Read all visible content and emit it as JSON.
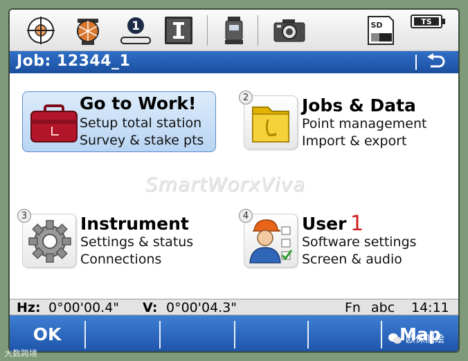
{
  "header": {
    "title": "Job: 12344_1"
  },
  "toolbar": {
    "icons": [
      "crosshair-target-icon",
      "prism-icon",
      "one-face-icon",
      "text-cursor-icon",
      "instrument-icon",
      "camera-icon",
      "sd-card-icon",
      "ts-battery-icon"
    ],
    "one_face_label": "1",
    "sd_label": "SD",
    "ts_label": "TS"
  },
  "tiles": [
    {
      "number": "",
      "title": "Go to Work!",
      "line1": "Setup total station",
      "line2": "Survey & stake pts",
      "icon": "toolbox-icon"
    },
    {
      "number": "2",
      "title": "Jobs & Data",
      "line1": "Point management",
      "line2": "Import & export",
      "icon": "folder-icon"
    },
    {
      "number": "3",
      "title": "Instrument",
      "line1": "Settings & status",
      "line2": "Connections",
      "icon": "gear-icon"
    },
    {
      "number": "4",
      "title": "User",
      "line1": "Software settings",
      "line2": "Screen & audio",
      "icon": "user-settings-icon"
    }
  ],
  "watermark": "SmartWorxViva",
  "annotation": "1",
  "status": {
    "hz_label": "Hz:",
    "hz_value": "0°00'00.4\"",
    "v_label": "V:",
    "v_value": "0°00'04.3\"",
    "fn": "Fn",
    "mode": "abc",
    "time": "14:11"
  },
  "softkeys": {
    "ok": "OK",
    "map": "Map"
  },
  "overlay": {
    "left": "大数跨境",
    "right": "欧侏测绘"
  },
  "colors": {
    "titlebar": "#1b4f9f",
    "softkeys": "#2a66bf",
    "selected_tile": "#b9d5f3",
    "annotation": "#d21f1f"
  }
}
